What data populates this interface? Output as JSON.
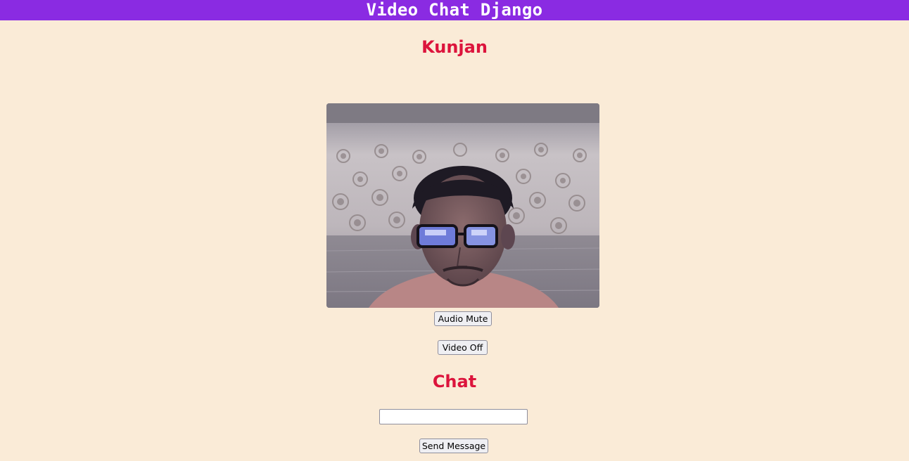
{
  "header": {
    "title": "Video Chat Django"
  },
  "user": {
    "name": "Kunjan"
  },
  "video": {
    "audio_button_label": "Audio Mute",
    "video_button_label": "Video Off"
  },
  "chat": {
    "title": "Chat",
    "input_value": "",
    "input_placeholder": "",
    "send_button_label": "Send Message"
  },
  "colors": {
    "header_bg": "#8a2be2",
    "page_bg": "#faebd7",
    "heading": "#dc143c"
  }
}
